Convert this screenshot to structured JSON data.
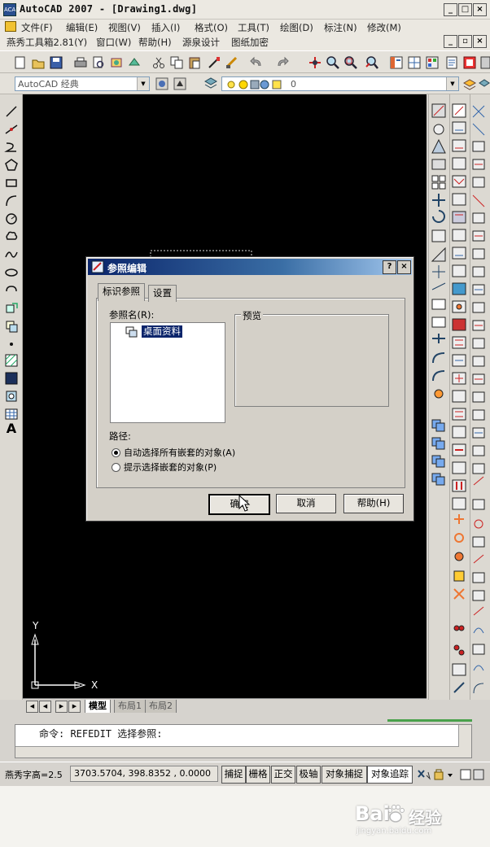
{
  "app": {
    "title": "AutoCAD 2007 - [Drawing1.dwg]",
    "icon_label": "ACAD"
  },
  "window_buttons": [
    "_",
    "□",
    "×"
  ],
  "doc_buttons": [
    "_",
    "▫",
    "×"
  ],
  "menu_row1": [
    "文件(F)",
    "编辑(E)",
    "视图(V)",
    "插入(I)",
    "格式(O)",
    "工具(T)",
    "绘图(D)",
    "标注(N)",
    "修改(M)"
  ],
  "menu_row2": [
    "燕秀工具箱2.81(Y)",
    "窗口(W)",
    "帮助(H)",
    "源泉设计",
    "图纸加密"
  ],
  "workspace": {
    "value": "AutoCAD 经典"
  },
  "layer": {
    "value": "0"
  },
  "layout_tabs": [
    "模型",
    "布局1",
    "布局2"
  ],
  "ucs": {
    "x_label": "X",
    "y_label": "Y"
  },
  "command": {
    "text": "命令: REFEDIT 选择参照:"
  },
  "status": {
    "text_height": "燕秀字高=2.5",
    "coords": "3703.5704,  398.8352 , 0.0000",
    "buttons": [
      "捕捉",
      "栅格",
      "正交",
      "极轴",
      "对象捕捉",
      "对象追踪"
    ]
  },
  "dialog": {
    "title": "参照编辑",
    "help_button": "?",
    "close_button": "×",
    "tabs": [
      "标识参照",
      "设置"
    ],
    "ref_label": "参照名(R):",
    "ref_item": "桌面资料",
    "preview_label": "预览",
    "path_label": "路径:",
    "radio_auto": "自动选择所有嵌套的对象(A)",
    "radio_prompt": "提示选择嵌套的对象(P)",
    "ok": "确定",
    "cancel": "取消",
    "help": "帮助(H)"
  },
  "watermark": {
    "brand": "Bai",
    "brand2": "经验",
    "url": "jingyan.baidu.com"
  }
}
